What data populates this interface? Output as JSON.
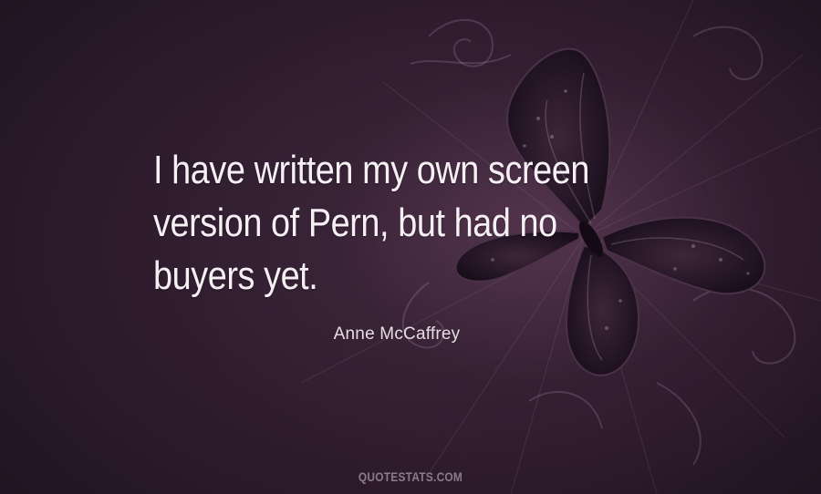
{
  "quote": {
    "lines": [
      "I have written my own screen",
      "version of Pern, but had no",
      "buyers yet."
    ]
  },
  "author": "Anne McCaffrey",
  "watermark": "QUOTESTATS.COM",
  "colors": {
    "background": "#2a1b2a",
    "text": "#f6f0f4",
    "butterfly": "#1e1220"
  },
  "decorations": {
    "butterfly": "butterfly-illustration",
    "swirls": "floral-swirl-ornament"
  }
}
